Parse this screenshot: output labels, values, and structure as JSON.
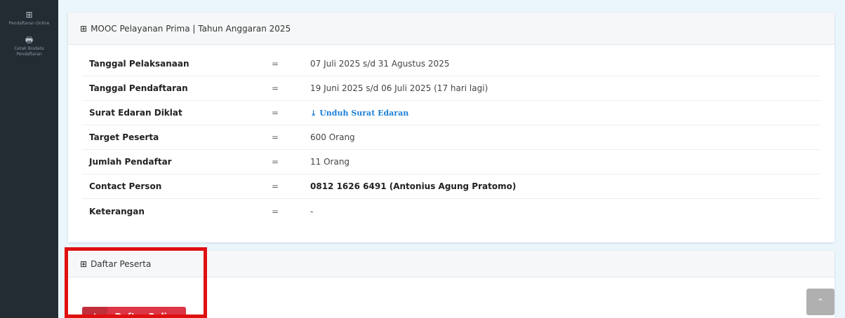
{
  "sidebar": {
    "items": [
      {
        "icon": "table-icon",
        "glyph": "⊞",
        "label": "Pendaftaran Online"
      },
      {
        "icon": "printer-icon",
        "glyph": "🖶",
        "label": "Cetak Biodata Pendaftaran"
      }
    ]
  },
  "info_panel": {
    "title_glyph": "⊞",
    "title": "MOOC Pelayanan Prima | Tahun Anggaran 2025",
    "rows": [
      {
        "label": "Tanggal Pelaksanaan",
        "eq": "=",
        "value": "07 Juli 2025 s/d 31 Agustus 2025"
      },
      {
        "label": "Tanggal Pendaftaran",
        "eq": "=",
        "value": "19 Juni 2025 s/d 06 Juli 2025 (17 hari lagi)"
      },
      {
        "label": "Surat Edaran Diklat",
        "eq": "=",
        "value": "Unduh Surat Edaran",
        "link_glyph": "⤓"
      },
      {
        "label": "Target Peserta",
        "eq": "=",
        "value": "600 Orang"
      },
      {
        "label": "Jumlah Pendaftar",
        "eq": "=",
        "value": "11 Orang"
      },
      {
        "label": "Contact Person",
        "eq": "=",
        "value": "0812 1626 6491 (Antonius Agung Pratomo)"
      },
      {
        "label": "Keterangan",
        "eq": "=",
        "value": "-"
      }
    ]
  },
  "participants_panel": {
    "title_glyph": "⊞",
    "title": "Daftar Peserta",
    "button_plus": "+",
    "button_label": "Daftar Online"
  },
  "scroll_top": {
    "icon": "chevron-up-icon",
    "glyph": "⌃"
  },
  "colors": {
    "background": "#eaf6fc",
    "sidebar": "#232b33",
    "button": "#dc3545",
    "link": "#1e7fd6",
    "highlight": "#e01010"
  }
}
